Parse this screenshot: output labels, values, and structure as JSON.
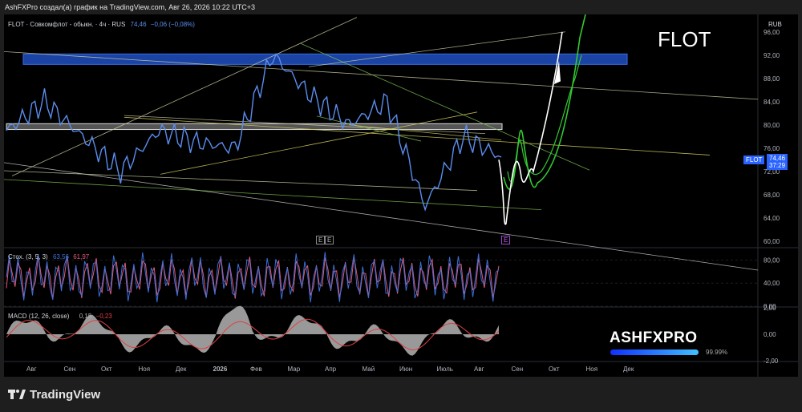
{
  "header": {
    "attribution": "AshFXPro создал(а) график на TradingView.com, Авг 26, 2026 10:22 UTC+3"
  },
  "main_pane": {
    "legend_prefix": "FLOT · Совкомфлот - обыкн. · 4ч · RUS",
    "legend_price": "74,46",
    "legend_change": "−0,06 (−0,08%)",
    "watermark": "FLOT",
    "currency": "RUB",
    "price_ticks": [
      "96,00",
      "92,00",
      "88,00",
      "84,00",
      "80,00",
      "76,00",
      "72,00",
      "68,00",
      "64,00",
      "60,00"
    ],
    "price_tag_symbol": "FLOT",
    "price_tag_value": "74,46",
    "price_tag_countdown": "37:29",
    "event_markers": [
      "E",
      "E",
      "E"
    ],
    "colors": {
      "price_line": "#5b8dee",
      "projection_white": "#ffffff",
      "projection_green": "#32c932",
      "zone_blue": "#1f4bb5",
      "zone_white": "#cccccc"
    }
  },
  "stoch_pane": {
    "name": "Стох. (3, 5, 3)",
    "k_value": "63,56",
    "d_value": "61,97",
    "ticks": [
      "80,00",
      "40,00",
      "0,00"
    ],
    "colors": {
      "k": "#3a6fd8",
      "d": "#e05a7a"
    }
  },
  "macd_pane": {
    "name": "MACD (12, 26, close)",
    "hist_value": "0,15",
    "signal_value": "−0,23",
    "ticks": [
      "2,00",
      "0,00",
      "-2,00"
    ],
    "colors": {
      "hist": "#b4b4b4",
      "signal": "#e04040"
    }
  },
  "time_axis": {
    "labels": [
      "Авг",
      "Сен",
      "Окт",
      "Ноя",
      "Дек",
      "2026",
      "Фев",
      "Мар",
      "Апр",
      "Май",
      "Июн",
      "Июль",
      "Авг",
      "Сен",
      "Окт",
      "Ноя",
      "Дек"
    ]
  },
  "branding": {
    "ashfxpro": "ASHFXPRO",
    "progress_label": "99.99%",
    "progress": 0.9999,
    "tradingview": "TradingView"
  },
  "chart_data": {
    "type": "line",
    "title": "FLOT · Совкомфлот - обыкн. · 4ч · RUS",
    "ylim": [
      59,
      99
    ],
    "x": [
      "Авг",
      "Сен",
      "Окт",
      "Ноя",
      "Дек",
      "2026",
      "Фев",
      "Мар",
      "Апр",
      "Май",
      "Июн",
      "Июль",
      "Авг",
      "Сен"
    ],
    "series": [
      {
        "name": "FLOT",
        "values": [
          79,
          84,
          78,
          72,
          79,
          77,
          76,
          92,
          85,
          80,
          84,
          66,
          78,
          74.46
        ]
      },
      {
        "name": "Стох. (3, 5, 3)",
        "values": [
          63.56
        ]
      },
      {
        "name": "MACD (12, 26, close)",
        "values": [
          0.15
        ]
      }
    ]
  }
}
